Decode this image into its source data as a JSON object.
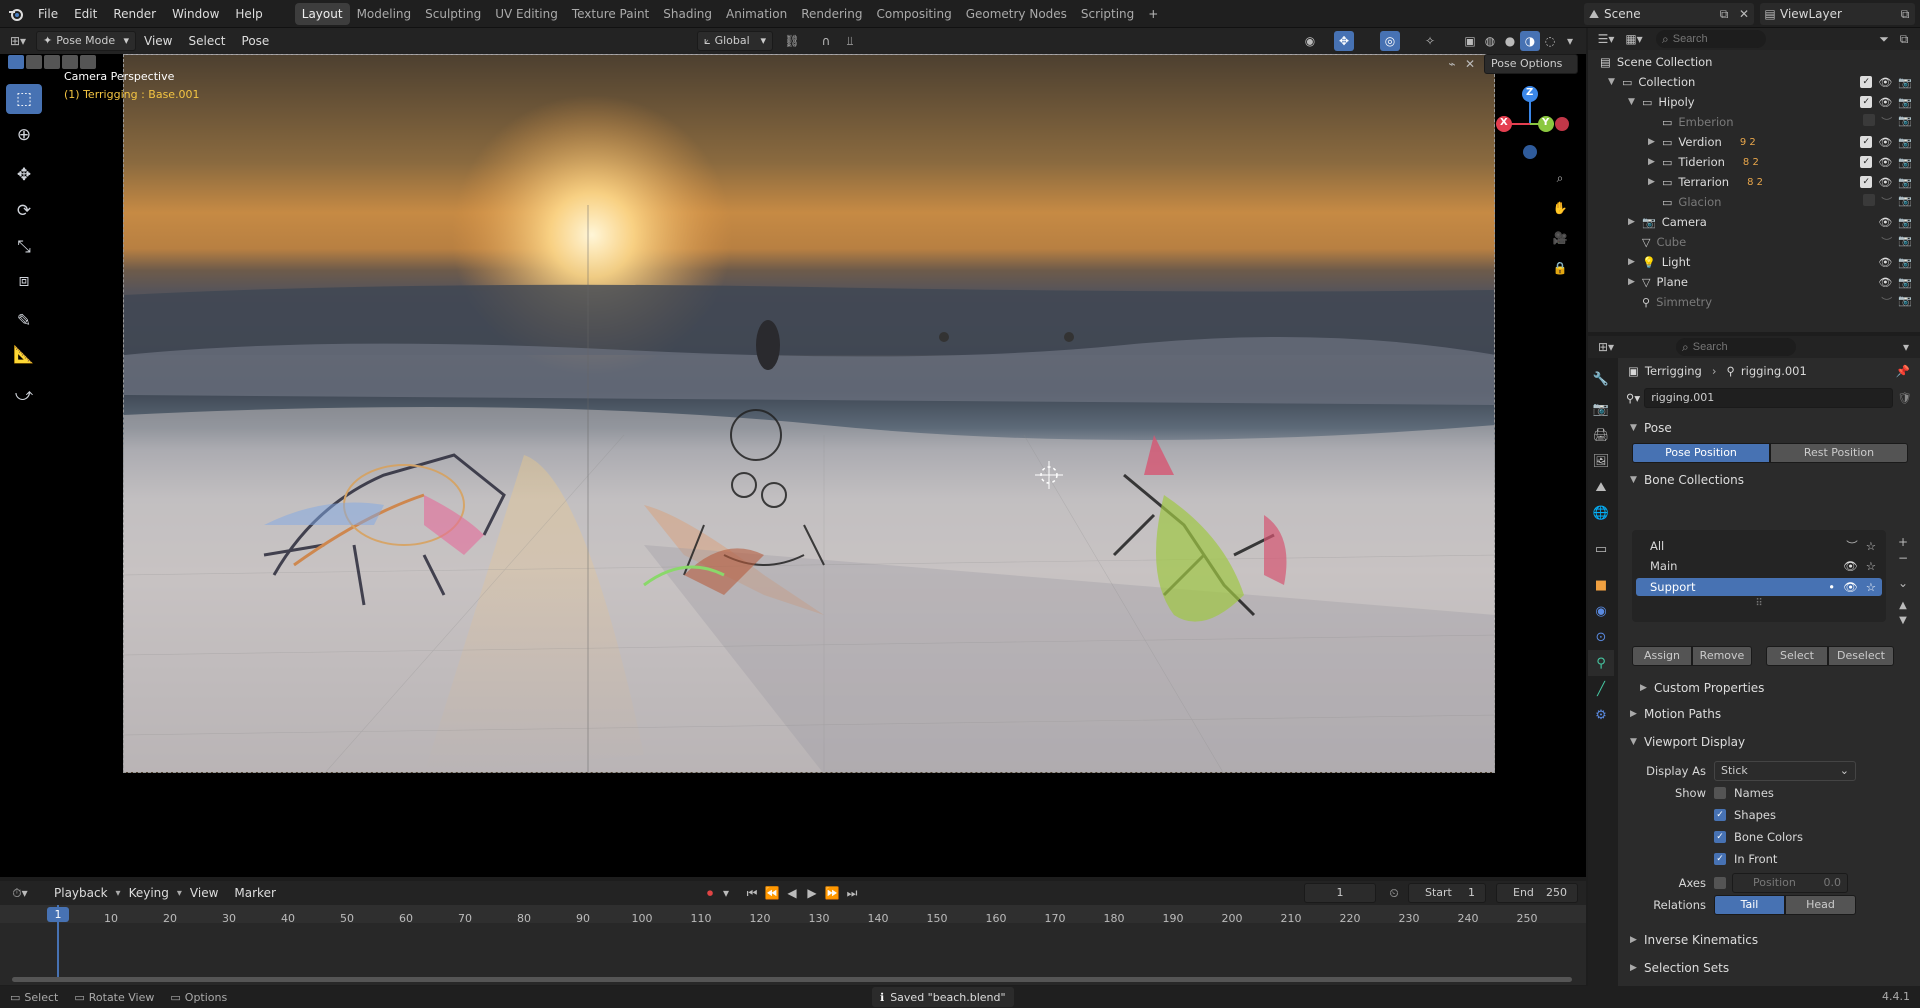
{
  "topbar": {
    "menus": [
      "File",
      "Edit",
      "Render",
      "Window",
      "Help"
    ],
    "workspaces": [
      "Layout",
      "Modeling",
      "Sculpting",
      "UV Editing",
      "Texture Paint",
      "Shading",
      "Animation",
      "Rendering",
      "Compositing",
      "Geometry Nodes",
      "Scripting"
    ],
    "active_workspace": "Layout",
    "scene": "Scene",
    "view_layer": "ViewLayer"
  },
  "viewport_header": {
    "mode": "Pose Mode",
    "menus": [
      "View",
      "Select",
      "Pose"
    ],
    "orientation": "Global",
    "pose_options": "Pose Options"
  },
  "viewport": {
    "camera_label": "Camera Perspective",
    "context_label": "(1) Terrigging : Base.001",
    "gizmo_axes": {
      "x": "X",
      "y": "Y",
      "z": "Z"
    }
  },
  "outliner": {
    "search_placeholder": "Search",
    "root": "Scene Collection",
    "items": [
      {
        "name": "Collection",
        "level": 0,
        "dim": false
      },
      {
        "name": "Hipoly",
        "level": 1,
        "dim": false
      },
      {
        "name": "Emberion",
        "level": 2,
        "dim": true
      },
      {
        "name": "Verdion",
        "level": 2,
        "dim": false,
        "badges": "9 2"
      },
      {
        "name": "Tiderion",
        "level": 2,
        "dim": false,
        "badges": "8 2"
      },
      {
        "name": "Terrarion",
        "level": 2,
        "dim": false,
        "badges": "8 2"
      },
      {
        "name": "Glacion",
        "level": 2,
        "dim": true
      },
      {
        "name": "Camera",
        "level": 1,
        "dim": false
      },
      {
        "name": "Cube",
        "level": 1,
        "dim": true
      },
      {
        "name": "Light",
        "level": 1,
        "dim": false
      },
      {
        "name": "Plane",
        "level": 1,
        "dim": false
      },
      {
        "name": "Simmetry",
        "level": 1,
        "dim": true
      }
    ]
  },
  "properties": {
    "search_placeholder": "Search",
    "breadcrumb": [
      "Terrigging",
      "rigging.001"
    ],
    "data_name": "rigging.001",
    "pose": {
      "title": "Pose",
      "pose_position": "Pose Position",
      "rest_position": "Rest Position"
    },
    "bone_collections": {
      "title": "Bone Collections",
      "items": [
        "All",
        "Main",
        "Support"
      ],
      "selected": "Support",
      "buttons": [
        "Assign",
        "Remove",
        "Select",
        "Deselect"
      ],
      "custom_properties": "Custom Properties"
    },
    "motion_paths": "Motion Paths",
    "viewport_display": {
      "title": "Viewport Display",
      "display_as_label": "Display As",
      "display_as_value": "Stick",
      "show_label": "Show",
      "names": "Names",
      "shapes": "Shapes",
      "bone_colors": "Bone Colors",
      "in_front": "In Front",
      "axes_label": "Axes",
      "position_label": "Position",
      "position_value": "0.0",
      "relations_label": "Relations",
      "tail": "Tail",
      "head": "Head"
    },
    "inverse_kinematics": "Inverse Kinematics",
    "selection_sets": "Selection Sets"
  },
  "timeline": {
    "menus": [
      "Playback",
      "Keying",
      "View",
      "Marker"
    ],
    "current_frame": "1",
    "start_label": "Start",
    "start_value": "1",
    "end_label": "End",
    "end_value": "250",
    "ruler": [
      "10",
      "20",
      "30",
      "40",
      "50",
      "60",
      "70",
      "80",
      "90",
      "100",
      "110",
      "120",
      "130",
      "140",
      "150",
      "160",
      "170",
      "180",
      "190",
      "200",
      "210",
      "220",
      "230",
      "240",
      "250"
    ],
    "playhead": "1"
  },
  "statusbar": {
    "select": "Select",
    "rotate_view": "Rotate View",
    "options": "Options",
    "message": "Saved \"beach.blend\"",
    "version": "4.4.1"
  }
}
